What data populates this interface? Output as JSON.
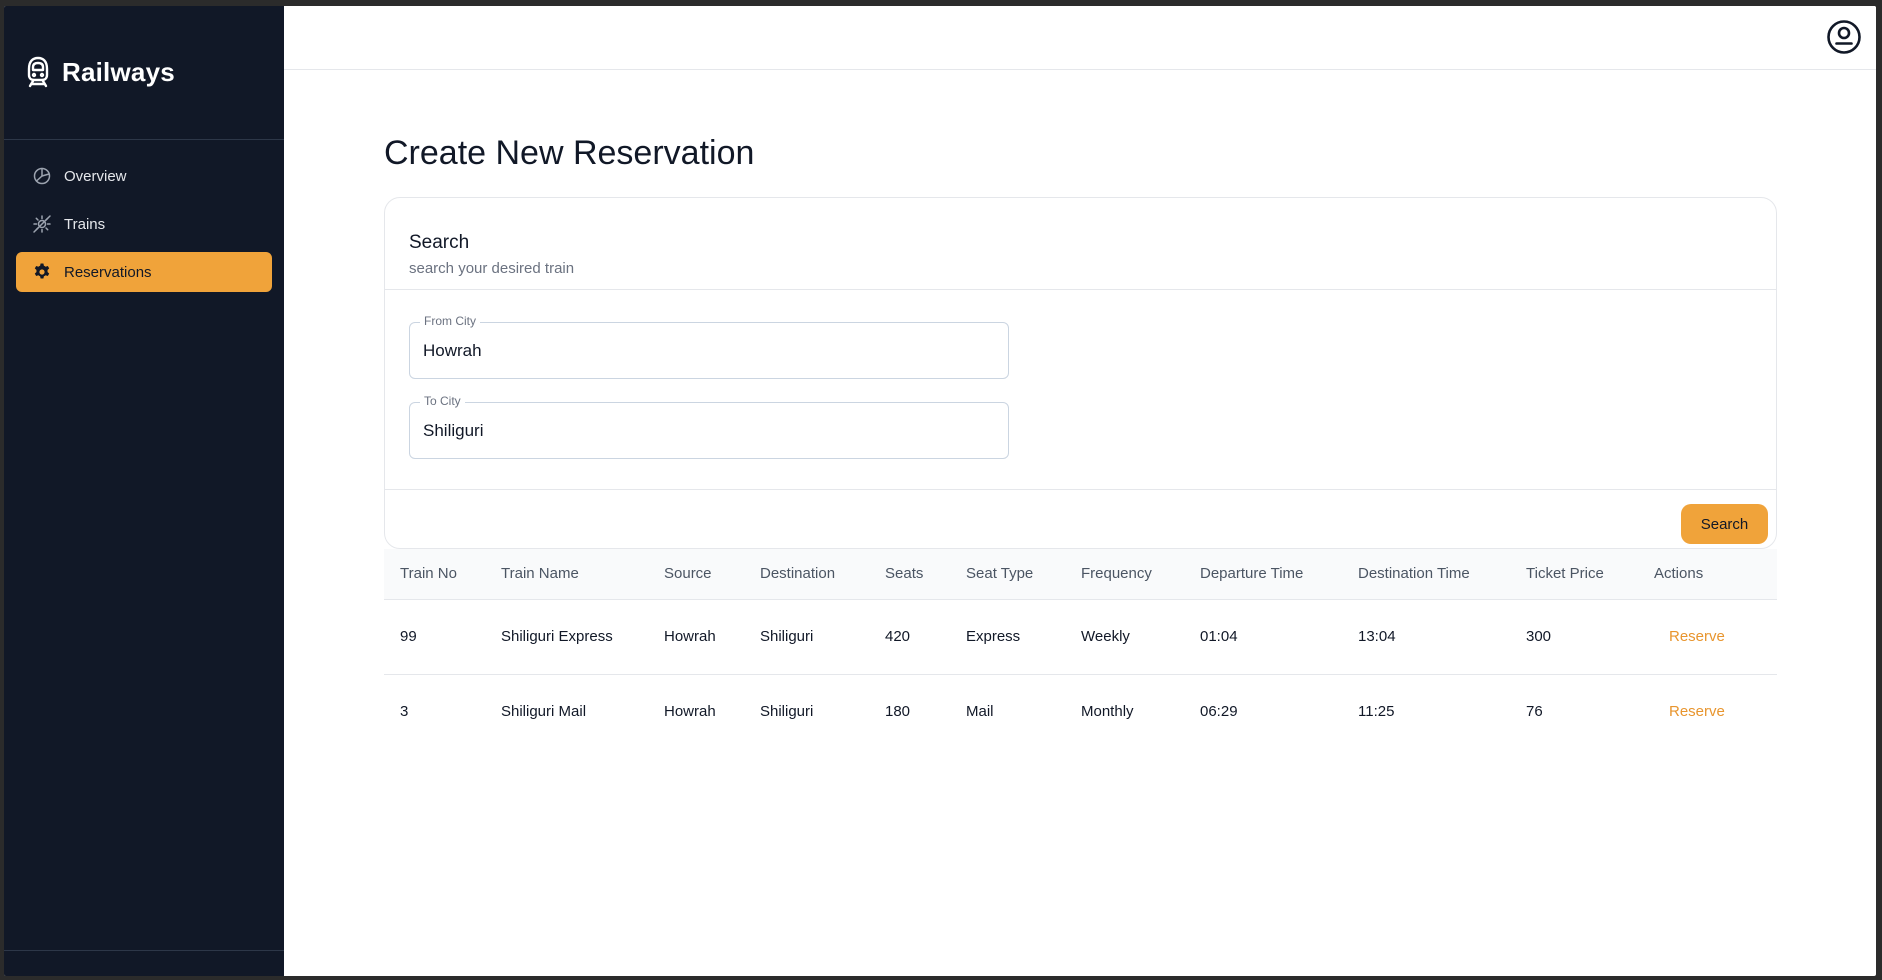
{
  "app": {
    "name": "Railways",
    "icon": "train-icon",
    "accent_color": "#f0a33a",
    "sidebar_color": "#111827"
  },
  "sidebar": {
    "items": [
      {
        "label": "Overview",
        "icon": "pie-chart-icon",
        "active": false
      },
      {
        "label": "Trains",
        "icon": "sparkle-icon",
        "active": false
      },
      {
        "label": "Reservations",
        "icon": "gear-icon",
        "active": true
      }
    ]
  },
  "header": {
    "profile_icon": "user-circle-icon"
  },
  "main": {
    "title": "Create New Reservation",
    "search_card": {
      "title": "Search",
      "subtitle": "search your desired train",
      "from_label": "From City",
      "from_value": "Howrah",
      "to_label": "To City",
      "to_value": "Shiliguri",
      "button_label": "Search"
    },
    "table": {
      "headers": [
        "Train No",
        "Train Name",
        "Source",
        "Destination",
        "Seats",
        "Seat Type",
        "Frequency",
        "Departure Time",
        "Destination Time",
        "Ticket Price",
        "Actions"
      ],
      "rows": [
        {
          "train_no": "99",
          "train_name": "Shiliguri Express",
          "source": "Howrah",
          "destination": "Shiliguri",
          "seats": "420",
          "seat_type": "Express",
          "frequency": "Weekly",
          "departure_time": "01:04",
          "destination_time": "13:04",
          "ticket_price": "300",
          "action": "Reserve"
        },
        {
          "train_no": "3",
          "train_name": "Shiliguri Mail",
          "source": "Howrah",
          "destination": "Shiliguri",
          "seats": "180",
          "seat_type": "Mail",
          "frequency": "Monthly",
          "departure_time": "06:29",
          "destination_time": "11:25",
          "ticket_price": "76",
          "action": "Reserve"
        }
      ]
    }
  }
}
